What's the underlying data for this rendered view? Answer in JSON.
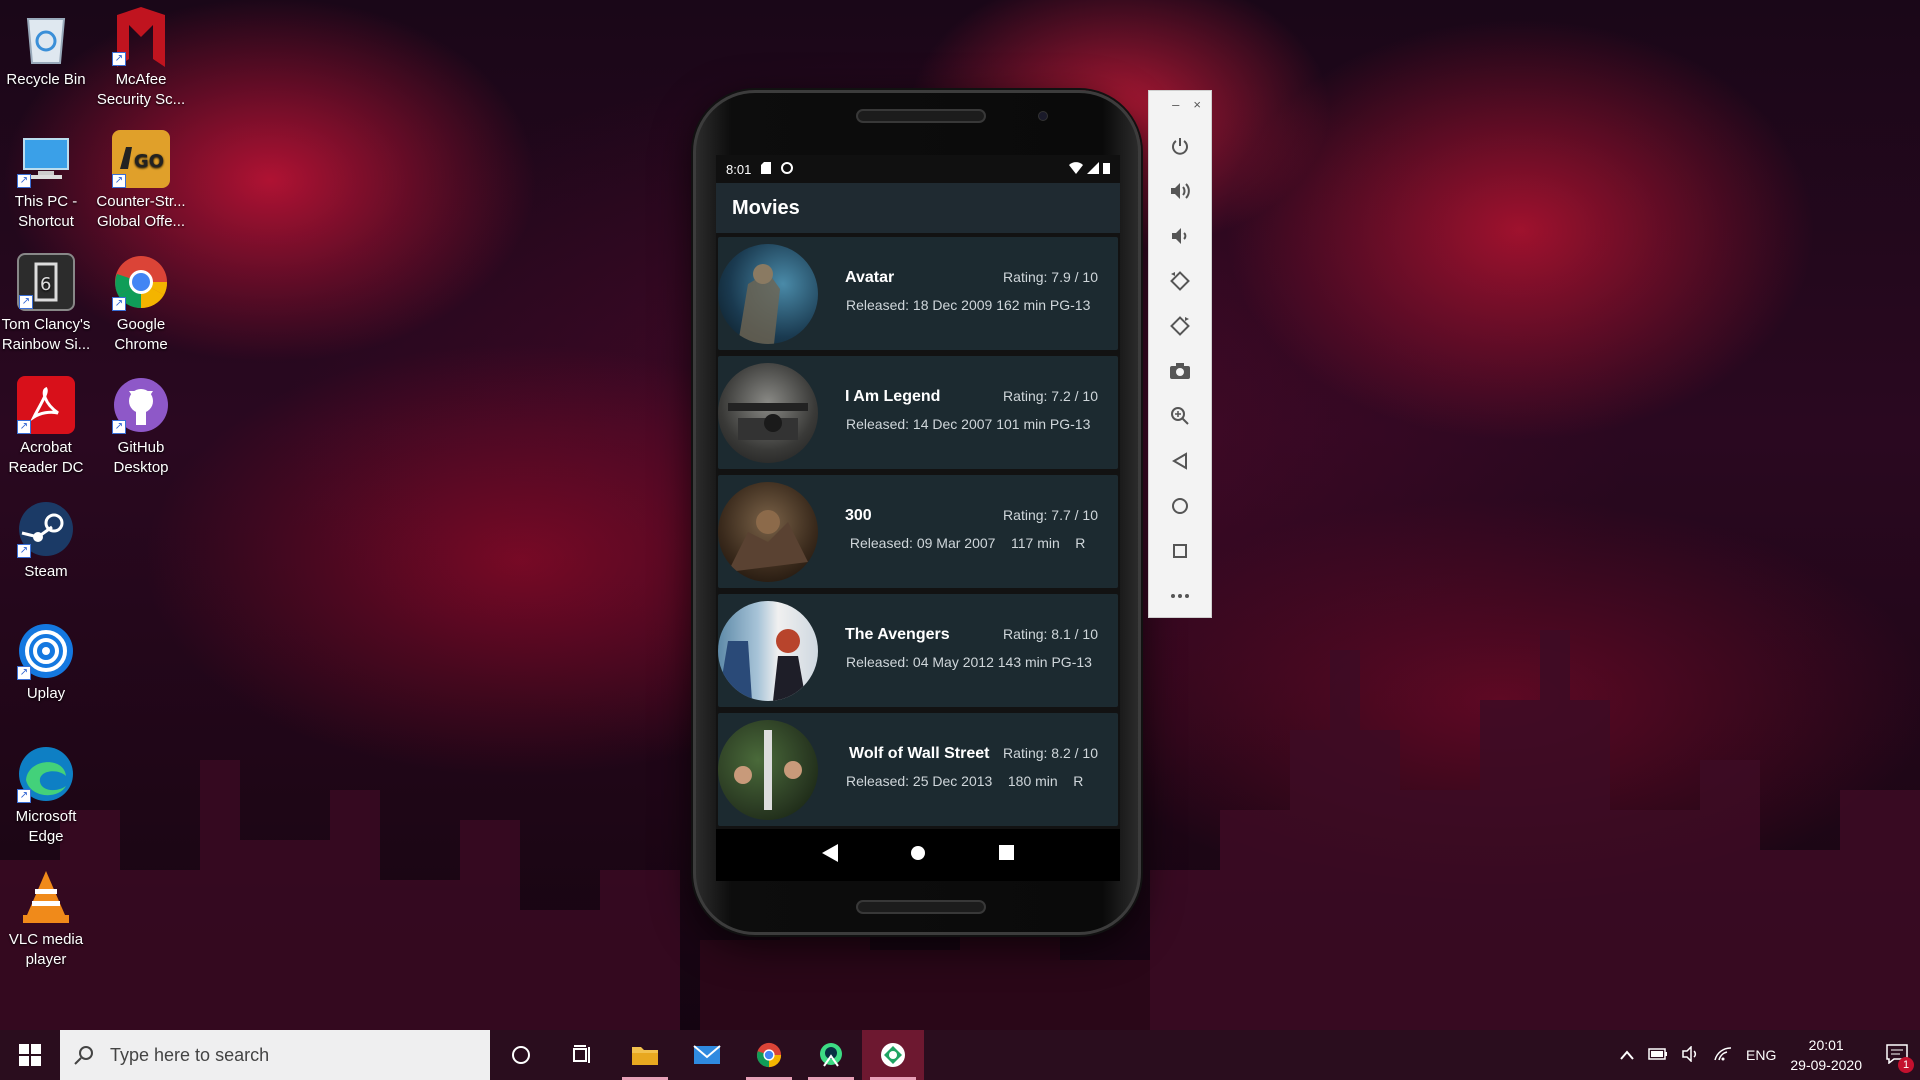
{
  "desktop": {
    "icons": [
      {
        "label": "Recycle Bin",
        "icon": "recycle-bin-icon"
      },
      {
        "label": "McAfee Security Sc...",
        "icon": "mcafee-icon"
      },
      {
        "label": "This PC - Shortcut",
        "icon": "this-pc-icon"
      },
      {
        "label": "Counter-Str... Global Offe...",
        "icon": "csgo-icon"
      },
      {
        "label": "Tom Clancy's Rainbow Si...",
        "icon": "rainbow-six-icon"
      },
      {
        "label": "Google Chrome",
        "icon": "chrome-icon"
      },
      {
        "label": "Acrobat Reader DC",
        "icon": "acrobat-icon"
      },
      {
        "label": "GitHub Desktop",
        "icon": "github-icon"
      },
      {
        "label": "Steam",
        "icon": "steam-icon"
      },
      {
        "label": "Uplay",
        "icon": "uplay-icon"
      },
      {
        "label": "Microsoft Edge",
        "icon": "edge-icon"
      },
      {
        "label": "VLC media player",
        "icon": "vlc-icon"
      }
    ]
  },
  "phone": {
    "status": {
      "time": "8:01"
    },
    "app_title": "Movies",
    "movies": [
      {
        "title": "Avatar",
        "rating": "Rating: 7.9 / 10",
        "meta": "Released: 18 Dec 2009 162 min PG-13"
      },
      {
        "title": "I Am Legend",
        "rating": "Rating: 7.2 / 10",
        "meta": "Released: 14 Dec 2007 101 min PG-13"
      },
      {
        "title": "300",
        "rating": "Rating: 7.7 / 10",
        "meta": " Released: 09 Mar 2007    117 min    R"
      },
      {
        "title": "The Avengers",
        "rating": "Rating: 8.1 / 10",
        "meta": "Released: 04 May 2012 143 min PG-13"
      },
      {
        "title": "Wolf of Wall Street",
        "rating": "Rating: 8.2 / 10",
        "meta": "Released: 25 Dec 2013    180 min    R"
      }
    ]
  },
  "emulator_toolbar": {
    "minimize": "–",
    "close": "×",
    "tools": [
      "power-icon",
      "volume-up-icon",
      "volume-down-icon",
      "rotate-left-icon",
      "rotate-right-icon",
      "camera-icon",
      "zoom-icon",
      "back-icon",
      "home-icon",
      "overview-icon",
      "more-icon"
    ]
  },
  "taskbar": {
    "search_placeholder": "Type here to search",
    "language": "ENG",
    "time": "20:01",
    "date": "29-09-2020",
    "notification_count": "1"
  },
  "colors": {
    "card_bg": "#1c2a30",
    "appbar_bg": "#1f2a31",
    "taskbar_bg": "#2a0d1e"
  }
}
